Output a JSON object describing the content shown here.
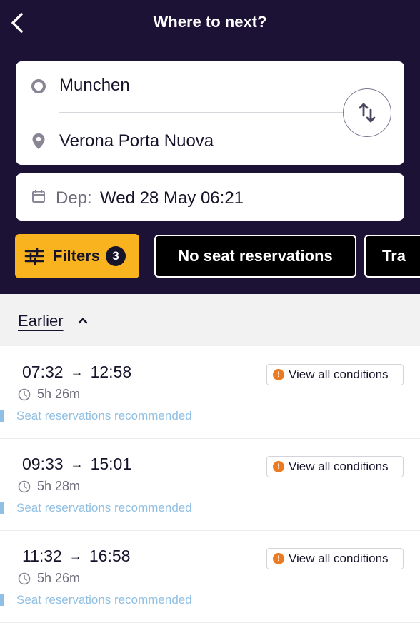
{
  "header": {
    "title": "Where to next?",
    "background": "#1b1236"
  },
  "route": {
    "origin": "Munchen",
    "destination": "Verona Porta Nuova"
  },
  "date": {
    "label": "Dep:",
    "value": "Wed 28 May 06:21"
  },
  "filters": {
    "label": "Filters",
    "count": "3",
    "accent": "#f9b31e",
    "chips": [
      "No seat reservations",
      "Tra"
    ]
  },
  "earlier": {
    "label": "Earlier"
  },
  "trips": [
    {
      "depart": "07:32",
      "arrive": "12:58",
      "duration": "5h 26m",
      "note": "Seat reservations recommended",
      "conditions_label": "View all conditions"
    },
    {
      "depart": "09:33",
      "arrive": "15:01",
      "duration": "5h 28m",
      "note": "Seat reservations recommended",
      "conditions_label": "View all conditions"
    },
    {
      "depart": "11:32",
      "arrive": "16:58",
      "duration": "5h 26m",
      "note": "Seat reservations recommended",
      "conditions_label": "View all conditions"
    }
  ],
  "icons": {
    "back": "chevron-left-icon",
    "origin": "circle-icon",
    "destination": "map-pin-icon",
    "swap": "swap-vertical-icon",
    "calendar": "calendar-icon",
    "filter": "sliders-icon",
    "earlier": "chevron-up-icon",
    "duration": "clock-icon",
    "conditions": "alert-icon"
  }
}
